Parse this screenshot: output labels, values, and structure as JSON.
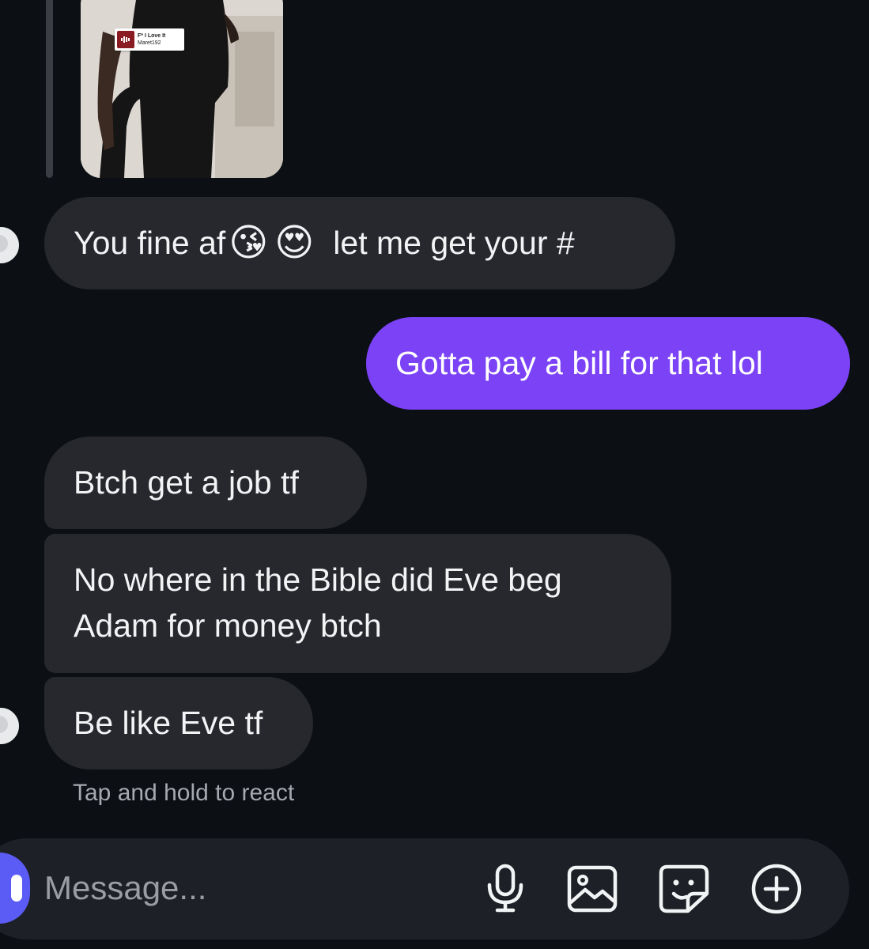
{
  "thread": {
    "story_reply": {
      "music_sticker": {
        "title": "F* I Love It",
        "artist": "Maret192"
      }
    },
    "messages": [
      {
        "sender": "them",
        "text_before": "You fine af",
        "emojis": [
          "😘",
          "😍"
        ],
        "text_after": "let me get your #"
      },
      {
        "sender": "me",
        "text": "Gotta pay a bill for that lol"
      },
      {
        "sender": "them",
        "text": "Btch get a job tf"
      },
      {
        "sender": "them",
        "text": "No where in the Bible did Eve beg Adam for money btch"
      },
      {
        "sender": "them",
        "text": "Be like Eve tf"
      }
    ],
    "react_hint": "Tap and hold to react"
  },
  "composer": {
    "placeholder": "Message...",
    "icons": [
      "microphone-icon",
      "image-icon",
      "sticker-icon",
      "add-circle-icon"
    ]
  },
  "colors": {
    "background": "#0c0f14",
    "incoming_bubble": "#26282d",
    "outgoing_bubble": "#7b42f6",
    "composer": "#1d2026"
  }
}
